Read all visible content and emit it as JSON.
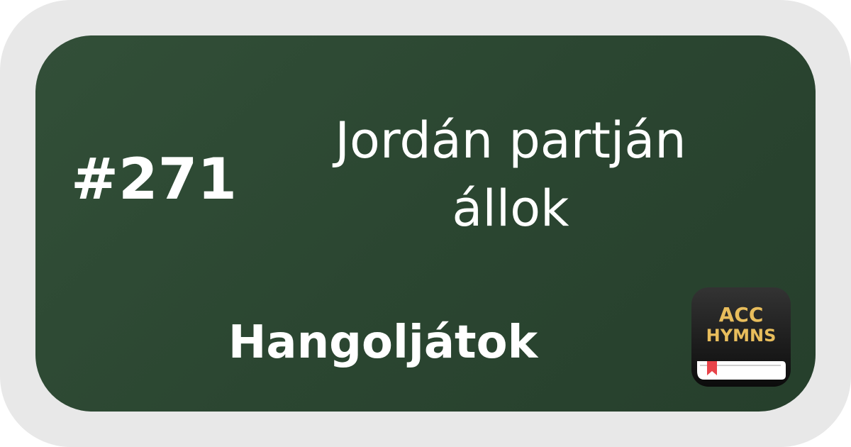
{
  "hymn": {
    "number": "#271",
    "title": "Jordán partján állok",
    "category": "Hangoljátok"
  },
  "app_logo": {
    "line1": "ACC",
    "line2": "HYMNS",
    "text_color": "#e8bd5c",
    "bookmark_color": "#e8444a"
  },
  "colors": {
    "card_background": "#2d4a33",
    "frame_background": "#e8e8e8",
    "text": "#ffffff"
  }
}
